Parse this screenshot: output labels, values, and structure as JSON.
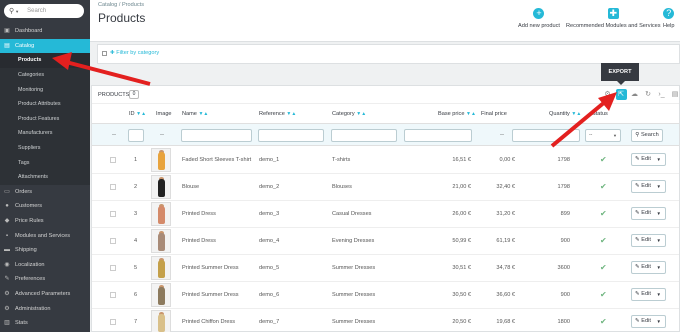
{
  "sidebar": {
    "search_placeholder": "Search",
    "items": [
      {
        "label": "Dashboard",
        "icon": "dashboard-icon",
        "glyph": "▣"
      },
      {
        "label": "Catalog",
        "icon": "catalog-icon",
        "glyph": "▤",
        "active": true
      },
      {
        "label": "Products",
        "sub": true,
        "current": true
      },
      {
        "label": "Categories",
        "sub": true
      },
      {
        "label": "Monitoring",
        "sub": true
      },
      {
        "label": "Product Attributes",
        "sub": true
      },
      {
        "label": "Product Features",
        "sub": true
      },
      {
        "label": "Manufacturers",
        "sub": true
      },
      {
        "label": "Suppliers",
        "sub": true
      },
      {
        "label": "Tags",
        "sub": true
      },
      {
        "label": "Attachments",
        "sub": true
      },
      {
        "label": "Orders",
        "icon": "orders-icon",
        "glyph": "▭"
      },
      {
        "label": "Customers",
        "icon": "customers-icon",
        "glyph": "●"
      },
      {
        "label": "Price Rules",
        "icon": "price-rules-icon",
        "glyph": "◆"
      },
      {
        "label": "Modules and Services",
        "icon": "modules-icon",
        "glyph": "▪"
      },
      {
        "label": "Shipping",
        "icon": "shipping-icon",
        "glyph": "▬"
      },
      {
        "label": "Localization",
        "icon": "localization-icon",
        "glyph": "◉"
      },
      {
        "label": "Preferences",
        "icon": "preferences-icon",
        "glyph": "✎"
      },
      {
        "label": "Advanced Parameters",
        "icon": "advanced-parameters-icon",
        "glyph": "⚙"
      },
      {
        "label": "Administration",
        "icon": "administration-icon",
        "glyph": "⚙"
      },
      {
        "label": "Stats",
        "icon": "stats-icon",
        "glyph": "▥"
      }
    ]
  },
  "header": {
    "breadcrumb": "Catalog  /  Products",
    "title": "Products",
    "buttons": [
      {
        "label": "Add new product",
        "icon": "plus-circle-icon",
        "glyph": "+"
      },
      {
        "label": "Recommended Modules and Services",
        "icon": "puzzle-icon",
        "glyph": "✚"
      },
      {
        "label": "Help",
        "icon": "help-icon",
        "glyph": "?"
      }
    ]
  },
  "category_filter": {
    "label": "Filter by category"
  },
  "panel": {
    "title": "Products",
    "count": "0",
    "tooltip": "EXPORT"
  },
  "table": {
    "headers": {
      "id": "ID",
      "image": "Image",
      "name": "Name",
      "reference": "Reference",
      "category": "Category",
      "base_price": "Base price",
      "final_price": "Final price",
      "quantity": "Quantity",
      "status": "Status"
    },
    "filter": {
      "dash": "--",
      "search": "Search"
    },
    "edit_label": "Edit",
    "rows": [
      {
        "id": "1",
        "name": "Faded Short Sleeves T-shirt",
        "ref": "demo_1",
        "category": "T-shirts",
        "base": "16,51 €",
        "final": "0,00 €",
        "qty": "1798",
        "color": "#e8a33d"
      },
      {
        "id": "2",
        "name": "Blouse",
        "ref": "demo_2",
        "category": "Blouses",
        "base": "21,00 €",
        "final": "32,40 €",
        "qty": "1798",
        "color": "#222222"
      },
      {
        "id": "3",
        "name": "Printed Dress",
        "ref": "demo_3",
        "category": "Casual Dresses",
        "base": "26,00 €",
        "final": "31,20 €",
        "qty": "899",
        "color": "#d48a6a"
      },
      {
        "id": "4",
        "name": "Printed Dress",
        "ref": "demo_4",
        "category": "Evening Dresses",
        "base": "50,99 €",
        "final": "61,19 €",
        "qty": "900",
        "color": "#a88b78"
      },
      {
        "id": "5",
        "name": "Printed Summer Dress",
        "ref": "demo_5",
        "category": "Summer Dresses",
        "base": "30,51 €",
        "final": "34,78 €",
        "qty": "3600",
        "color": "#c4a04a"
      },
      {
        "id": "6",
        "name": "Printed Summer Dress",
        "ref": "demo_6",
        "category": "Summer Dresses",
        "base": "30,50 €",
        "final": "36,60 €",
        "qty": "900",
        "color": "#8c7a5e"
      },
      {
        "id": "7",
        "name": "Printed Chiffon Dress",
        "ref": "demo_7",
        "category": "Summer Dresses",
        "base": "20,50 €",
        "final": "19,68 €",
        "qty": "1800",
        "color": "#d9c08a"
      }
    ]
  },
  "colors": {
    "accent": "#25b9d7",
    "sidebar_bg": "#363a41",
    "status_ok": "#70b580",
    "annotation": "#e3201f"
  }
}
